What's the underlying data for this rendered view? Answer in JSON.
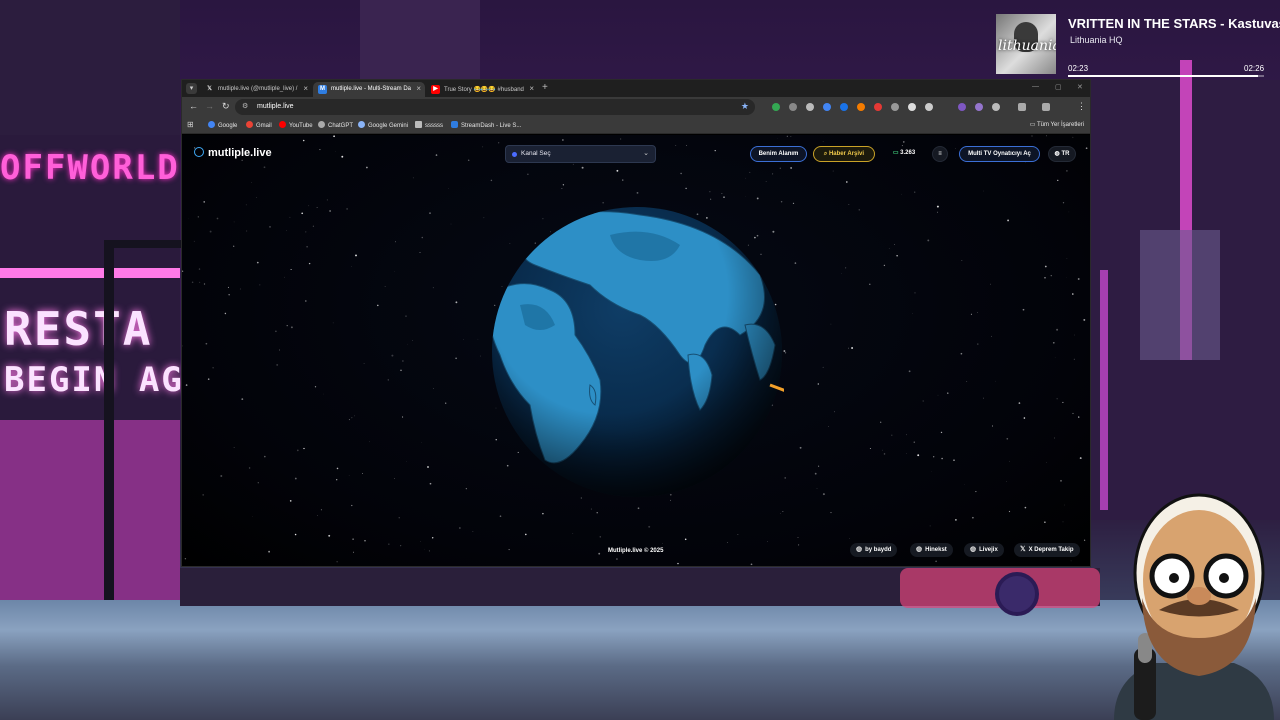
{
  "music_widget": {
    "cover_text": "lithuania",
    "title": "VRITTEN IN THE STARS - Kastuvas",
    "artist": "Lithuania HQ",
    "time_current": "02:23",
    "time_total": "02:26",
    "progress": 0.97
  },
  "backdrop": {
    "neon_signs": [
      "OFFWORLD",
      "RESTA",
      "BEGIN AG"
    ]
  },
  "browser": {
    "tabs": [
      {
        "title": "mutliple.live (@mutliple_live) /",
        "favicon": "x-icon",
        "active": false
      },
      {
        "title": "mutliple.live - Multi-Stream Da",
        "favicon": "site-icon",
        "active": true
      },
      {
        "title": "True Story 😂😂😂 #husband",
        "favicon": "youtube-icon",
        "active": false
      }
    ],
    "url": "mutliple.live",
    "bookmarks": [
      {
        "label": "Google",
        "color": "#4285f4"
      },
      {
        "label": "Gmail",
        "color": "#ea4335"
      },
      {
        "label": "YouTube",
        "color": "#ff0000"
      },
      {
        "label": "ChatGPT",
        "color": "#aaaaaa"
      },
      {
        "label": "Google Gemini",
        "color": "#8ab4f8"
      },
      {
        "label": "ssssss",
        "color": "#bbbbbb"
      },
      {
        "label": "StreamDash - Live S...",
        "color": "#2f7de1"
      }
    ],
    "all_bookmarks": "Tüm Yer İşaretleri"
  },
  "page": {
    "logo": "mutliple.live",
    "channel_select": "Kanal Seç",
    "buttons": {
      "my_area": "Benim Alanım",
      "news_archive": "Haber Arşivi",
      "viewers": "3.263",
      "menu": "≡",
      "multi_tv": "Multi TV Oynatıcıyı Aç",
      "language": "TR"
    },
    "footer": {
      "copyright": "Mutliple.live © 2025",
      "links": [
        "by baydd",
        "Hinekst",
        "Livejix",
        "X Deprem Takip"
      ]
    },
    "colors": {
      "accent_blue": "#3b6fd6",
      "accent_yellow": "#f0c94b",
      "globe_ocean": "#0a2a4a",
      "globe_land": "#2d8fc6"
    }
  }
}
